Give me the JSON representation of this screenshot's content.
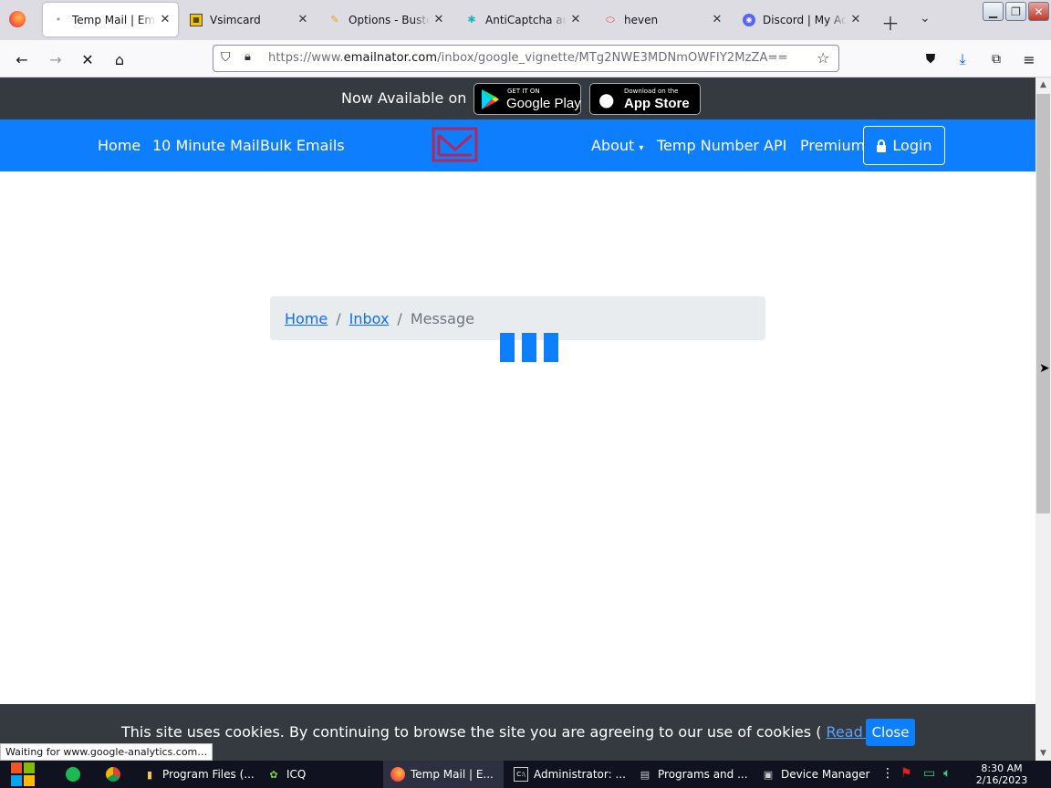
{
  "browser": {
    "tabs": [
      {
        "label": "Temp Mail | Email",
        "icon": "loading-dot-icon",
        "active": true
      },
      {
        "label": "Vsimcard",
        "icon": "sim-card-icon"
      },
      {
        "label": "Options - Buster",
        "icon": "buster-icon"
      },
      {
        "label": "AntiCaptcha autom",
        "icon": "anticaptcha-icon"
      },
      {
        "label": "heven",
        "icon": "heven-icon"
      },
      {
        "label": "Discord | My Acco",
        "icon": "discord-icon"
      }
    ],
    "url_prefix": "https://www.",
    "url_domain": "emailnator.com",
    "url_path": "/inbox/google_vignette/MTg2NWE3MDNmOWFIY2MzZA=="
  },
  "page": {
    "promo_text": "Now Available on",
    "google_play_small": "GET IT ON",
    "google_play_big": "Google Play",
    "app_store_small": "Download on the",
    "app_store_big": "App Store",
    "nav_left": [
      "Home",
      "10 Minute Mail",
      "Bulk Emails"
    ],
    "nav_right": {
      "about": "About",
      "temp_number": "Temp Number",
      "api": "API",
      "premium": "Premium"
    },
    "login": "Login",
    "breadcrumb": {
      "home": "Home",
      "inbox": "Inbox",
      "current": "Message"
    },
    "cookie_text_before": "This site uses cookies. By continuing to browse the site you are agreeing to our use of cookies (",
    "cookie_link": "Read more",
    "cookie_text_after": ")",
    "cookie_close": "Close",
    "brand_color": "#0d7efe"
  },
  "status_text": "Waiting for www.google-analytics.com…",
  "taskbar": {
    "items": [
      {
        "label": "Program Files (..."
      },
      {
        "label": "ICQ"
      },
      {
        "label": "Temp Mail | E..."
      },
      {
        "label": "Administrator: ..."
      },
      {
        "label": "Programs and ..."
      },
      {
        "label": "Device Manager"
      }
    ],
    "time": "8:30 AM",
    "date": "2/16/2023"
  }
}
